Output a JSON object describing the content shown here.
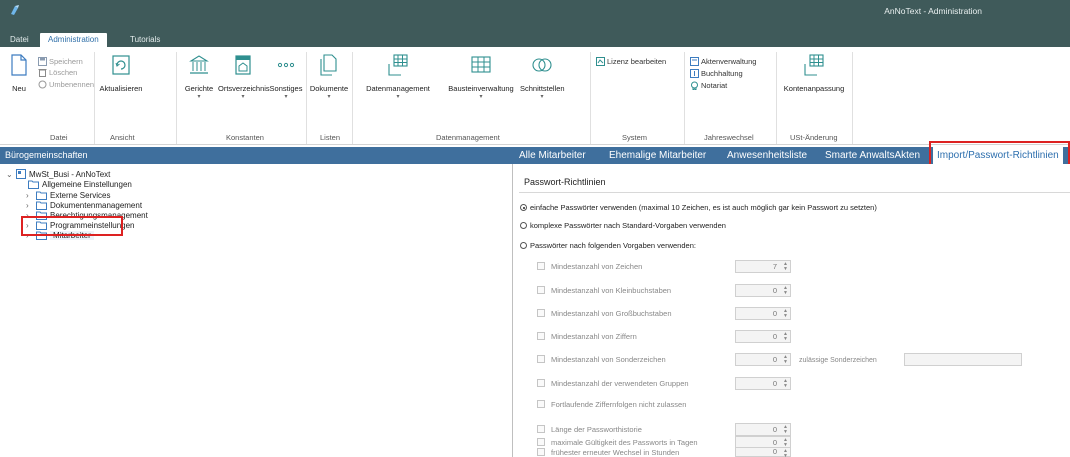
{
  "window": {
    "title": "AnNoText - Administration"
  },
  "ribbon_tabs": [
    "Datei",
    "Administration",
    "Tutorials"
  ],
  "ribbon": {
    "datei": {
      "new_label": "Neu",
      "save_label": "Speichern",
      "delete_label": "Löschen",
      "rename_label": "Umbenennen",
      "group": "Datei"
    },
    "ansicht": {
      "refresh_label": "Aktualisieren",
      "group": "Ansicht"
    },
    "konstanten": {
      "courts_label": "Gerichte",
      "places_label": "Ortsverzeichnis",
      "misc_label": "Sonstiges",
      "group": "Konstanten"
    },
    "listen": {
      "documents_label": "Dokumente",
      "group": "Listen"
    },
    "datenmanagement": {
      "data_label": "Datenmanagement",
      "text_label": "Bausteinverwaltung",
      "interfaces_label": "Schnittstellen",
      "group": "Datenmanagement"
    },
    "system": {
      "license_label": "Lizenz bearbeiten",
      "group": "System"
    },
    "jahreswechsel": {
      "files_label": "Aktenverwaltung",
      "accounting_label": "Buchhaltung",
      "notary_label": "Notariat",
      "group": "Jahreswechsel"
    },
    "ust": {
      "accounts_label": "Kontenanpassung",
      "group": "USt-Änderung"
    }
  },
  "left_pane": {
    "title": "Bürogemeinschaften",
    "root": "MwSt_Busi - AnNoText",
    "items": [
      "Allgemeine Einstellungen",
      "Externe Services",
      "Dokumentenmanagement",
      "Berechtigungsmanagement",
      "Programmeinstellungen",
      "Mitarbeiter"
    ]
  },
  "right_tabs": [
    "Alle Mitarbeiter",
    "Ehemalige Mitarbeiter",
    "Anwesenheitsliste",
    "Smarte AnwaltsAkten",
    "Import/Passwort-Richtlinien"
  ],
  "password_policy": {
    "title": "Passwort-Richtlinien",
    "options": [
      {
        "label": "einfache Passwörter verwenden (maximal 10 Zeichen, es ist auch möglich gar kein Passwort zu setzten)",
        "selected": true
      },
      {
        "label": "komplexe Passwörter nach Standard-Vorgaben verwenden",
        "selected": false
      },
      {
        "label": "Passwörter nach folgenden Vorgaben verwenden:",
        "selected": false
      }
    ],
    "rules": [
      {
        "label": "Mindestanzahl von Zeichen",
        "value": "7"
      },
      {
        "label": "Mindestanzahl von Kleinbuchstaben",
        "value": "0"
      },
      {
        "label": "Mindestanzahl von Großbuchstaben",
        "value": "0"
      },
      {
        "label": "Mindestanzahl von Ziffern",
        "value": "0"
      },
      {
        "label": "Mindestanzahl von Sonderzeichen",
        "value": "0"
      },
      {
        "label": "Mindestanzahl der verwendeten Gruppen",
        "value": "0"
      },
      {
        "label": "Fortlaufende Ziffernfolgen nicht zulassen",
        "value": null
      },
      {
        "label": "Länge der Passworthistorie",
        "value": "0"
      },
      {
        "label": "maximale Gültigkeit des Passworts in Tagen",
        "value": "0"
      },
      {
        "label": "frühester erneuter Wechsel in Stunden",
        "value": "0"
      }
    ],
    "special_chars_label": "zulässige Sonderzeichen"
  },
  "colors": {
    "titlebar": "#3f5a5a",
    "header_blue": "#3f6f9d",
    "highlight_red": "#dd2222",
    "active_tab_text": "#2d6fae"
  }
}
